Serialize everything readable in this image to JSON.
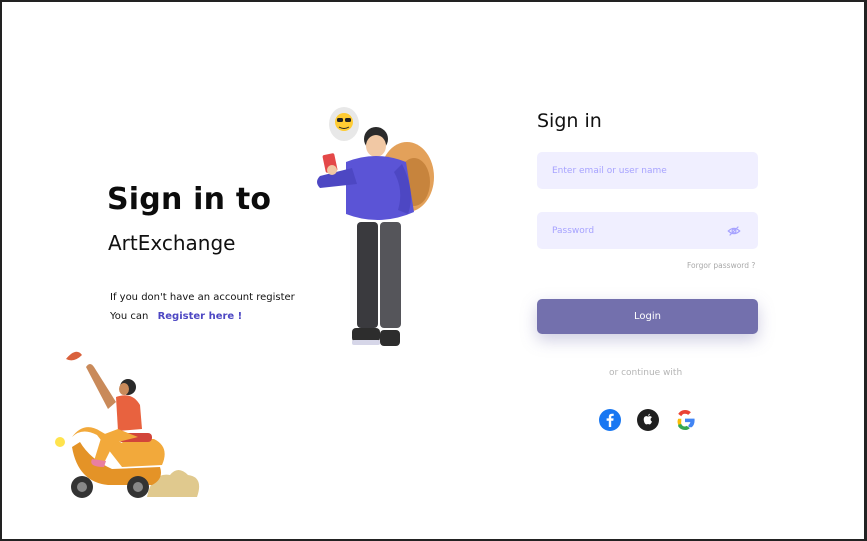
{
  "left": {
    "title_line1": "Sign in to",
    "title_line2": "ArtExchange",
    "register_prompt": "If you don't have an account register",
    "register_prefix": "You can",
    "register_link": "Register here !"
  },
  "form": {
    "title": "Sign in",
    "email_placeholder": "Enter email or user name",
    "password_placeholder": "Password",
    "forgot_password": "Forgor password ?",
    "login_label": "Login",
    "continue_text": "or continue with"
  },
  "social": {
    "items": [
      {
        "name": "facebook-icon",
        "color": "#1877f2"
      },
      {
        "name": "apple-icon",
        "color": "#1f1f1f"
      },
      {
        "name": "google-icon",
        "color": "#4285f4"
      }
    ]
  },
  "colors": {
    "accent": "#4d47c3",
    "login_button": "#7370ad",
    "input_bg": "#f0efff",
    "placeholder": "#a7a3ff"
  }
}
